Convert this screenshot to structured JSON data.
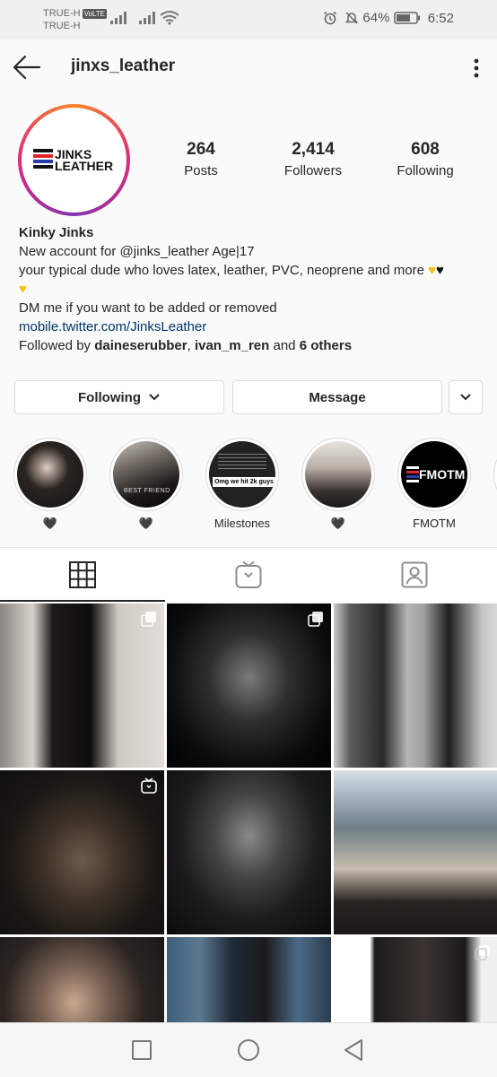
{
  "status_bar": {
    "carrier_1": "TRUE-H",
    "volte": "VoLTE",
    "carrier_2": "TRUE-H",
    "battery": "64%",
    "time": "6:52"
  },
  "header": {
    "username": "jinxs_leather"
  },
  "profile": {
    "logo_text_1": "JINKS",
    "logo_text_2": "LEATHER",
    "stats": [
      {
        "value": "264",
        "label": "Posts"
      },
      {
        "value": "2,414",
        "label": "Followers"
      },
      {
        "value": "608",
        "label": "Following"
      }
    ],
    "display_name": "Kinky Jinks",
    "bio_line1": "New account for @jinks_leather Age|17",
    "bio_line2": "your typical dude who loves latex, leather, PVC, neoprene and more",
    "bio_line3": "DM me if you want to be added or removed",
    "link": "mobile.twitter.com/JinksLeather",
    "followed_by_prefix": "Followed by ",
    "followed_user_1": "daineserubber",
    "followed_sep": ", ",
    "followed_user_2": "ivan_m_ren",
    "followed_and": " and ",
    "followed_others": "6 others"
  },
  "actions": {
    "following_label": "Following",
    "message_label": "Message"
  },
  "highlights": [
    {
      "label": "🖤"
    },
    {
      "label": "🖤"
    },
    {
      "label": "Milestones"
    },
    {
      "label": "🖤"
    },
    {
      "label": "FMOTM"
    }
  ],
  "highlight_texts": {
    "best_friend": "BEST FRIEND",
    "milestone_caption": "Omg we hit 2k guys",
    "fmotm_logo": "FMOTM"
  },
  "tabs": [
    "grid-icon",
    "igtv-icon",
    "tagged-icon"
  ],
  "colors": {
    "accent_link": "#003569",
    "story_gradient": [
      "#f58529",
      "#dd2a7b",
      "#8134af"
    ],
    "logo_red": "#e0262b",
    "logo_blue": "#2a3ea8"
  }
}
